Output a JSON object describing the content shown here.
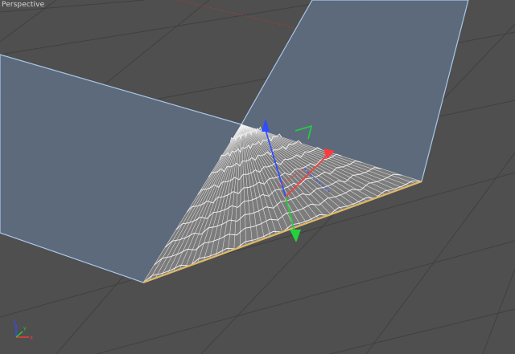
{
  "viewport": {
    "label": "Perspective",
    "background_color": "#4f4f4f",
    "grid_color": "#3e3e3e",
    "plane_color": "#5e6d80",
    "plane_edge_color": "#a9c7e8",
    "mesh_color": "#f2f2f2",
    "mesh_edge_color": "#e0b865"
  },
  "gizmo": {
    "x_color": "#ff3a3a",
    "y_color": "#23d23a",
    "z_color": "#2f4dff"
  },
  "axis_indicator": {
    "x_label": "X",
    "y_label": "Y",
    "z_label": "Z"
  }
}
